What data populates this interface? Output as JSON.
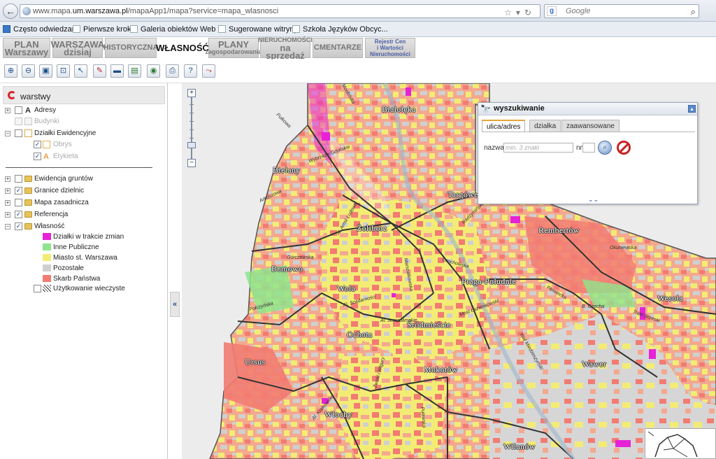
{
  "browser": {
    "url_prefix": "www.mapa.",
    "url_host": "um.warszawa.pl",
    "url_path": "/mapaApp1/mapa?service=mapa_wlasnosci",
    "search_placeholder": "Google",
    "bookmarks": [
      "Często odwiedzane",
      "Pierwsze kroki",
      "Galeria obiektów Web ...",
      "Sugerowane witryny",
      "Szkoła Języków Obcyc..."
    ]
  },
  "apptabs": [
    {
      "line1": "PLAN",
      "line2": "Warszawy"
    },
    {
      "line1": "WARSZAWA",
      "line2": "dzisiaj"
    },
    {
      "line1": "HISTORYCZNA",
      "line2": ""
    },
    {
      "line1": "WŁASNOŚĆ",
      "line2": ""
    },
    {
      "line1": "PLANY",
      "line2": "zagospodarowania"
    },
    {
      "line1": "NIERUCHOMOŚCI",
      "line2": "na sprzedaż"
    },
    {
      "line1": "CMENTARZE",
      "line2": ""
    },
    {
      "line1": "Rejestr Cen",
      "line2": "i Wartości",
      "line3": "Nieruchomości"
    }
  ],
  "toolbar": {
    "tools": [
      "zoom-in",
      "zoom-out",
      "zoom-box",
      "zoom-extent",
      "pointer",
      "identify",
      "measure",
      "layers",
      "globe",
      "print",
      "help",
      "route"
    ]
  },
  "layers": {
    "title": "warstwy",
    "items": [
      {
        "label": "Adresy",
        "checked": false,
        "type": "text"
      },
      {
        "label": "Budynki",
        "checked": false,
        "type": "disabled"
      },
      {
        "label": "Działki Ewidencyjne",
        "checked": false,
        "type": "folder-open"
      },
      {
        "label": "Obrys",
        "checked": true,
        "type": "sub"
      },
      {
        "label": "Etykieta",
        "checked": true,
        "type": "sub-text"
      },
      {
        "label": "Ewidencja gruntów",
        "checked": false,
        "type": "folder"
      },
      {
        "label": "Granice dzielnic",
        "checked": true,
        "type": "folder"
      },
      {
        "label": "Mapa zasadnicza",
        "checked": false,
        "type": "folder"
      },
      {
        "label": "Referencja",
        "checked": true,
        "type": "folder"
      },
      {
        "label": "Własność",
        "checked": true,
        "type": "folder"
      }
    ],
    "legend": [
      {
        "label": "Działki w trakcie zmian",
        "color": "#e622d6"
      },
      {
        "label": "Inne Publiczne",
        "color": "#8ee58c"
      },
      {
        "label": "Miasto st. Warszawa",
        "color": "#f3ec74"
      },
      {
        "label": "Pozostałe",
        "color": "#cfcfcf"
      },
      {
        "label": "Skarb Państwa",
        "color": "#f27b72"
      }
    ],
    "usage_label": "Użytkowanie wieczyste"
  },
  "collapse_label": "«",
  "map": {
    "districts": [
      "Białołęka",
      "Bielany",
      "Targówek",
      "Żoliborz",
      "Rembertów",
      "Bemowo",
      "Wola",
      "Praga-Południe",
      "Wesoła",
      "Śródmieście",
      "Ochota",
      "Ursus",
      "Mokotów",
      "Wawer",
      "Włochy",
      "Wilanów"
    ],
    "streets": [
      "Modlińska",
      "Pułkowa",
      "Wybrzeże Gdyńskie",
      "Arkuszowa",
      "Al. Armii Ludowej",
      "Radzymińska",
      "Okuniewska",
      "Grochowska",
      "Al. Solidarności",
      "Marszałkowska",
      "Most Łazienkowski",
      "Wał Miedzeszyński",
      "Trakt Brzeski",
      "B. Czecha",
      "Al. Jerozolimskie",
      "Puławska",
      "Górczewska",
      "Połczyńska",
      "Al. Krakowska",
      "Żwirki i Wigury",
      "Płowiecka"
    ]
  },
  "search": {
    "title": "wyszukiwanie",
    "tabs": [
      "ulica/adres",
      "działka",
      "zaawansowane"
    ],
    "name_label": "nazwa",
    "name_placeholder": "min. 3 znaki",
    "nr_label": "nr",
    "footer": "⌄⌄"
  }
}
